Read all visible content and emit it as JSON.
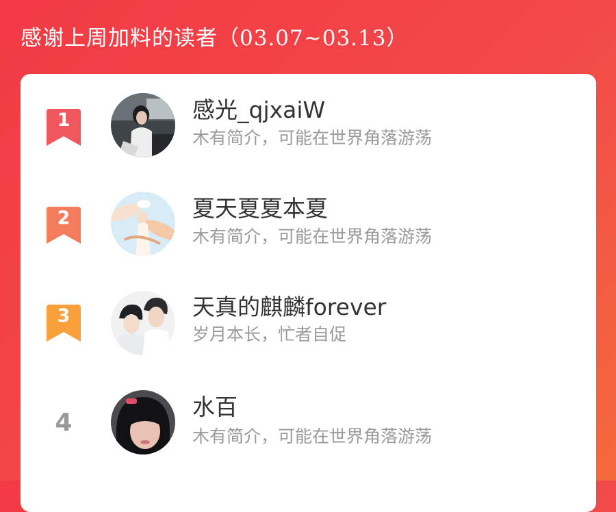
{
  "header": {
    "title": "感谢上周加料的读者（03.07~03.13）"
  },
  "readers": [
    {
      "rank": "1",
      "name": "感光_qjxaiW",
      "bio": "木有简介，可能在世界角落游荡",
      "badge_color": "#f0575e"
    },
    {
      "rank": "2",
      "name": "夏天夏夏本夏",
      "bio": "木有简介，可能在世界角落游荡",
      "badge_color": "#f47c5c"
    },
    {
      "rank": "3",
      "name": "天真的麒麟forever",
      "bio": "岁月本长，忙者自促",
      "badge_color": "#f9a03a"
    },
    {
      "rank": "4",
      "name": "水百",
      "bio": "木有简介，可能在世界角落游荡"
    }
  ],
  "colors": {
    "background": "#f23a44",
    "rank_plain": "#999999",
    "name_text": "#333333",
    "bio_text": "#9a9a9a"
  }
}
